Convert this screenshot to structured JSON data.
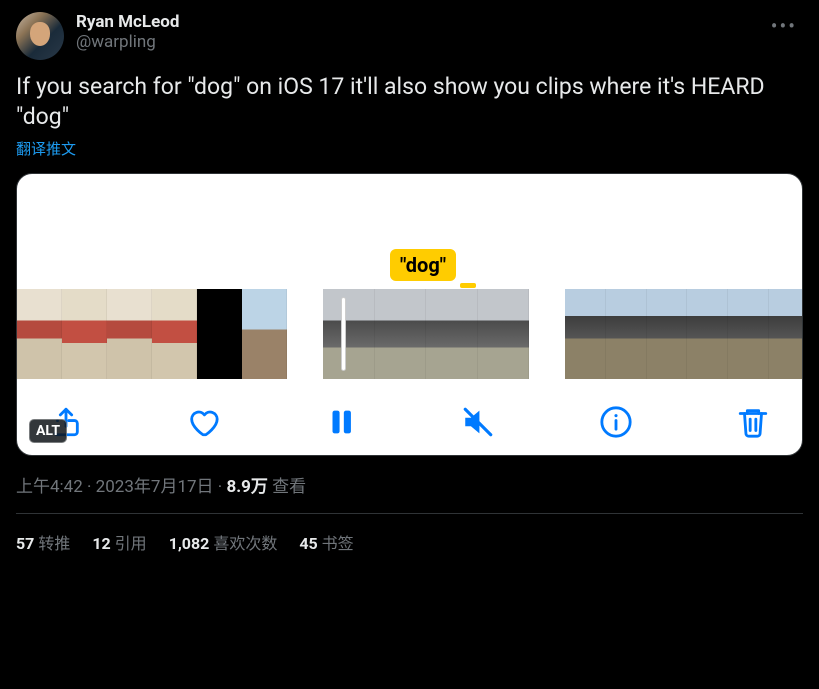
{
  "author": {
    "display_name": "Ryan McLeod",
    "handle": "@warpling"
  },
  "body": "If you search for \"dog\" on iOS 17 it'll also show you clips where it's HEARD \"dog\"",
  "translate_label": "翻译推文",
  "media": {
    "caption_chip": "\"dog\"",
    "alt_badge": "ALT"
  },
  "meta": {
    "time": "上午4:42",
    "date": "2023年7月17日",
    "views_number": "8.9万",
    "views_label": "查看"
  },
  "stats": {
    "retweets": {
      "num": "57",
      "label": "转推"
    },
    "quotes": {
      "num": "12",
      "label": "引用"
    },
    "likes": {
      "num": "1,082",
      "label": "喜欢次数"
    },
    "bookmarks": {
      "num": "45",
      "label": "书签"
    }
  }
}
